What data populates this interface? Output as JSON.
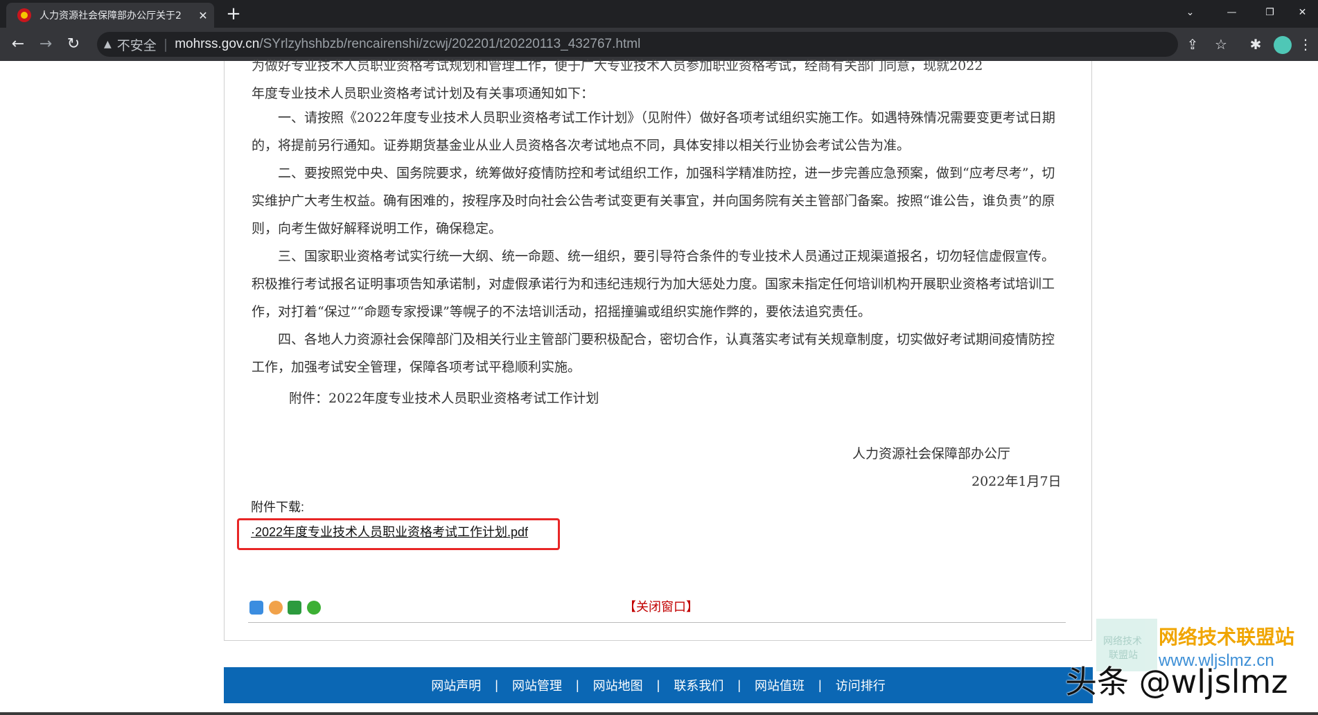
{
  "browser": {
    "tab_title": "人力资源社会保障部办公厅关于2",
    "tab_close": "✕",
    "new_tab": "+",
    "security_label": "不安全",
    "url_host": "mohrss.gov.cn",
    "url_path": "/SYrlzyhshbzb/rencairenshi/zcwj/202201/t20220113_432767.html",
    "controls": {
      "dropdown": "⌄",
      "minimize": "—",
      "restore": "❐",
      "close": "✕"
    },
    "nav": {
      "back": "←",
      "forward": "→",
      "reload": "↻"
    },
    "toolbar_icons": {
      "share": "⇪",
      "star": "☆",
      "extensions": "✱",
      "menu": "⋮"
    }
  },
  "article": {
    "clipped_top_line": "为做好专业技术人员职业资格考试规划和管理工作，便于广大专业技术人员参加职业资格考试，经商有关部门同意，现就2022",
    "intro_tail": "年度专业技术人员职业资格考试计划及有关事项通知如下：",
    "paragraphs": [
      "一、请按照《2022年度专业技术人员职业资格考试工作计划》（见附件）做好各项考试组织实施工作。如遇特殊情况需要变更考试日期的，将提前另行通知。证券期货基金业从业人员资格各次考试地点不同，具体安排以相关行业协会考试公告为准。",
      "二、要按照党中央、国务院要求，统筹做好疫情防控和考试组织工作，加强科学精准防控，进一步完善应急预案，做到“应考尽考”，切实维护广大考生权益。确有困难的，按程序及时向社会公告考试变更有关事宜，并向国务院有关主管部门备案。按照“谁公告，谁负责”的原则，向考生做好解释说明工作，确保稳定。",
      "三、国家职业资格考试实行统一大纲、统一命题、统一组织，要引导符合条件的专业技术人员通过正规渠道报名，切勿轻信虚假宣传。积极推行考试报名证明事项告知承诺制，对虚假承诺行为和违纪违规行为加大惩处力度。国家未指定任何培训机构开展职业资格考试培训工作，对打着“保过”“命题专家授课”等幌子的不法培训活动，招摇撞骗或组织实施作弊的，要依法追究责任。",
      "四、各地人力资源社会保障部门及相关行业主管部门要积极配合，密切合作，认真落实考试有关规章制度，切实做好考试期间疫情防控工作，加强考试安全管理，保障各项考试平稳顺利实施。"
    ],
    "attachment_note": "附件：2022年度专业技术人员职业资格考试工作计划",
    "signature": "人力资源社会保障部办公厅",
    "date": "2022年1月7日",
    "download_label": "附件下载:",
    "download_link": "·2022年度专业技术人员职业资格考试工作计划.pdf",
    "close_window": "【关闭窗口】"
  },
  "share_icons": [
    "qzone-icon",
    "weibo-icon",
    "douban-icon",
    "wechat-icon"
  ],
  "footer": {
    "links": [
      "网站声明",
      "网站管理",
      "网站地图",
      "联系我们",
      "网站值班",
      "访问排行"
    ],
    "separator": "|"
  },
  "watermark": {
    "logo_line1": "网络技术",
    "logo_line2": "联盟站",
    "name": "网络技术联盟站",
    "url": "www.wljslmz.cn",
    "handle": "头条 @wljslmz"
  },
  "colors": {
    "highlight_border": "#e82626",
    "footer_bg": "#0b67b4",
    "close_window": "#c20000"
  }
}
